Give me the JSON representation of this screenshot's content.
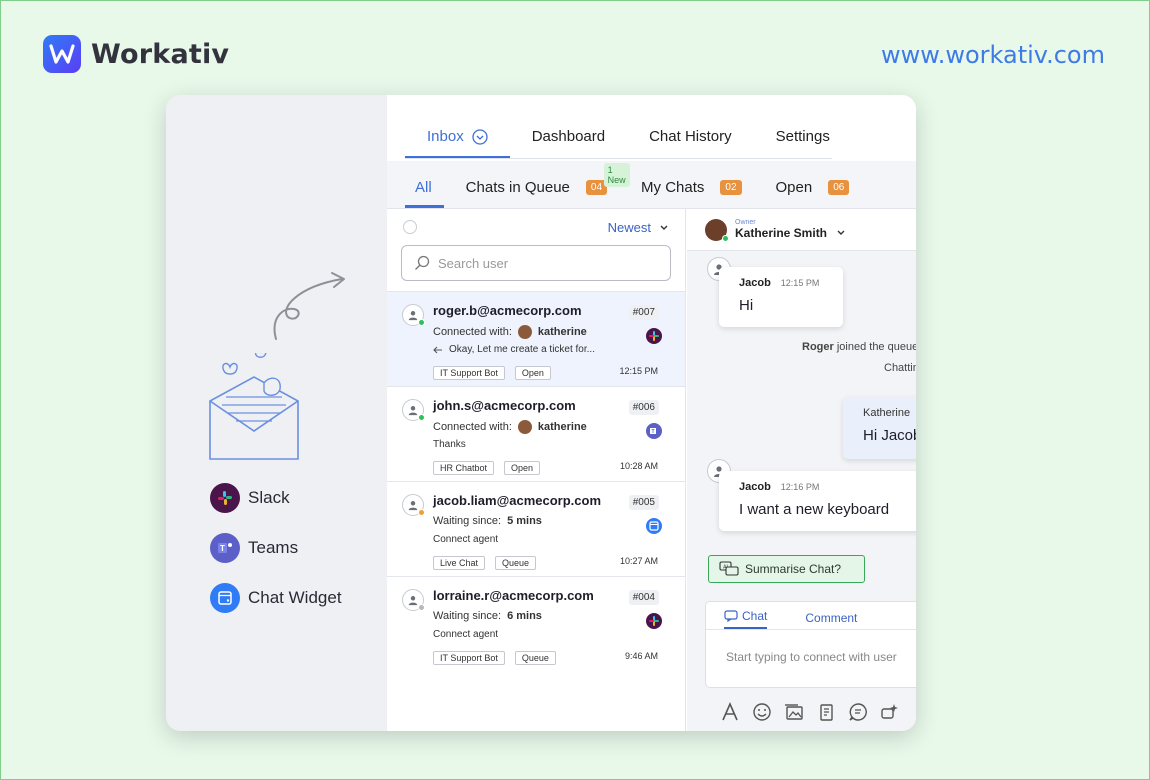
{
  "brand": {
    "name": "Workativ",
    "url": "www.workativ.com"
  },
  "channels": [
    {
      "label": "Slack",
      "icon": "slack-icon"
    },
    {
      "label": "Teams",
      "icon": "teams-icon"
    },
    {
      "label": "Chat Widget",
      "icon": "chat-widget-icon"
    }
  ],
  "topnav": [
    {
      "label": "Inbox",
      "active": true
    },
    {
      "label": "Dashboard"
    },
    {
      "label": "Chat History"
    },
    {
      "label": "Settings"
    }
  ],
  "subnav": {
    "all": "All",
    "queue": {
      "label": "Chats in Queue",
      "count": "04",
      "badge": "1 New"
    },
    "mine": {
      "label": "My Chats",
      "count": "02"
    },
    "open": {
      "label": "Open",
      "count": "06"
    }
  },
  "list": {
    "sort": "Newest",
    "search_placeholder": "Search user",
    "rows": [
      {
        "email": "roger.b@acmecorp.com",
        "id": "#007",
        "line1_label": "Connected with:",
        "line1_value": "katherine",
        "line2": "Okay, Let me create a ticket for...",
        "tags": [
          "IT Support Bot",
          "Open"
        ],
        "time": "12:15 PM",
        "status_color": "#2cc15a",
        "channel": "slack"
      },
      {
        "email": "john.s@acmecorp.com",
        "id": "#006",
        "line1_label": "Connected with:",
        "line1_value": "katherine",
        "line2": "Thanks",
        "tags": [
          "HR Chatbot",
          "Open"
        ],
        "time": "10:28 AM",
        "status_color": "#2cc15a",
        "channel": "teams"
      },
      {
        "email": "jacob.liam@acmecorp.com",
        "id": "#005",
        "line1_label": "Waiting since:",
        "line1_value": "5 mins",
        "line2": "Connect agent",
        "tags": [
          "Live Chat",
          "Queue"
        ],
        "time": "10:27 AM",
        "status_color": "#f0a030",
        "channel": "widget"
      },
      {
        "email": "lorraine.r@acmecorp.com",
        "id": "#004",
        "line1_label": "Waiting since:",
        "line1_value": "6 mins",
        "line2": "Connect agent",
        "tags": [
          "IT Support Bot",
          "Queue"
        ],
        "time": "9:46 AM",
        "status_color": "#b5b8bf",
        "channel": "slack"
      }
    ]
  },
  "chat": {
    "owner_label": "Owner",
    "owner_name": "Katherine Smith",
    "messages": [
      {
        "name": "Jacob",
        "time": "12:15 PM",
        "text": "Hi"
      },
      {
        "name": "Katherine",
        "text": "Hi Jacob"
      },
      {
        "name": "Jacob",
        "time": "12:16 PM",
        "text": "I want a new keyboard"
      }
    ],
    "system_1_name": "Roger",
    "system_1_text": "joined the queue",
    "system_2_text": "Chatting",
    "summarise": "Summarise Chat?",
    "composer_tabs": [
      "Chat",
      "Comment"
    ],
    "composer_placeholder": "Start typing to connect with user"
  }
}
